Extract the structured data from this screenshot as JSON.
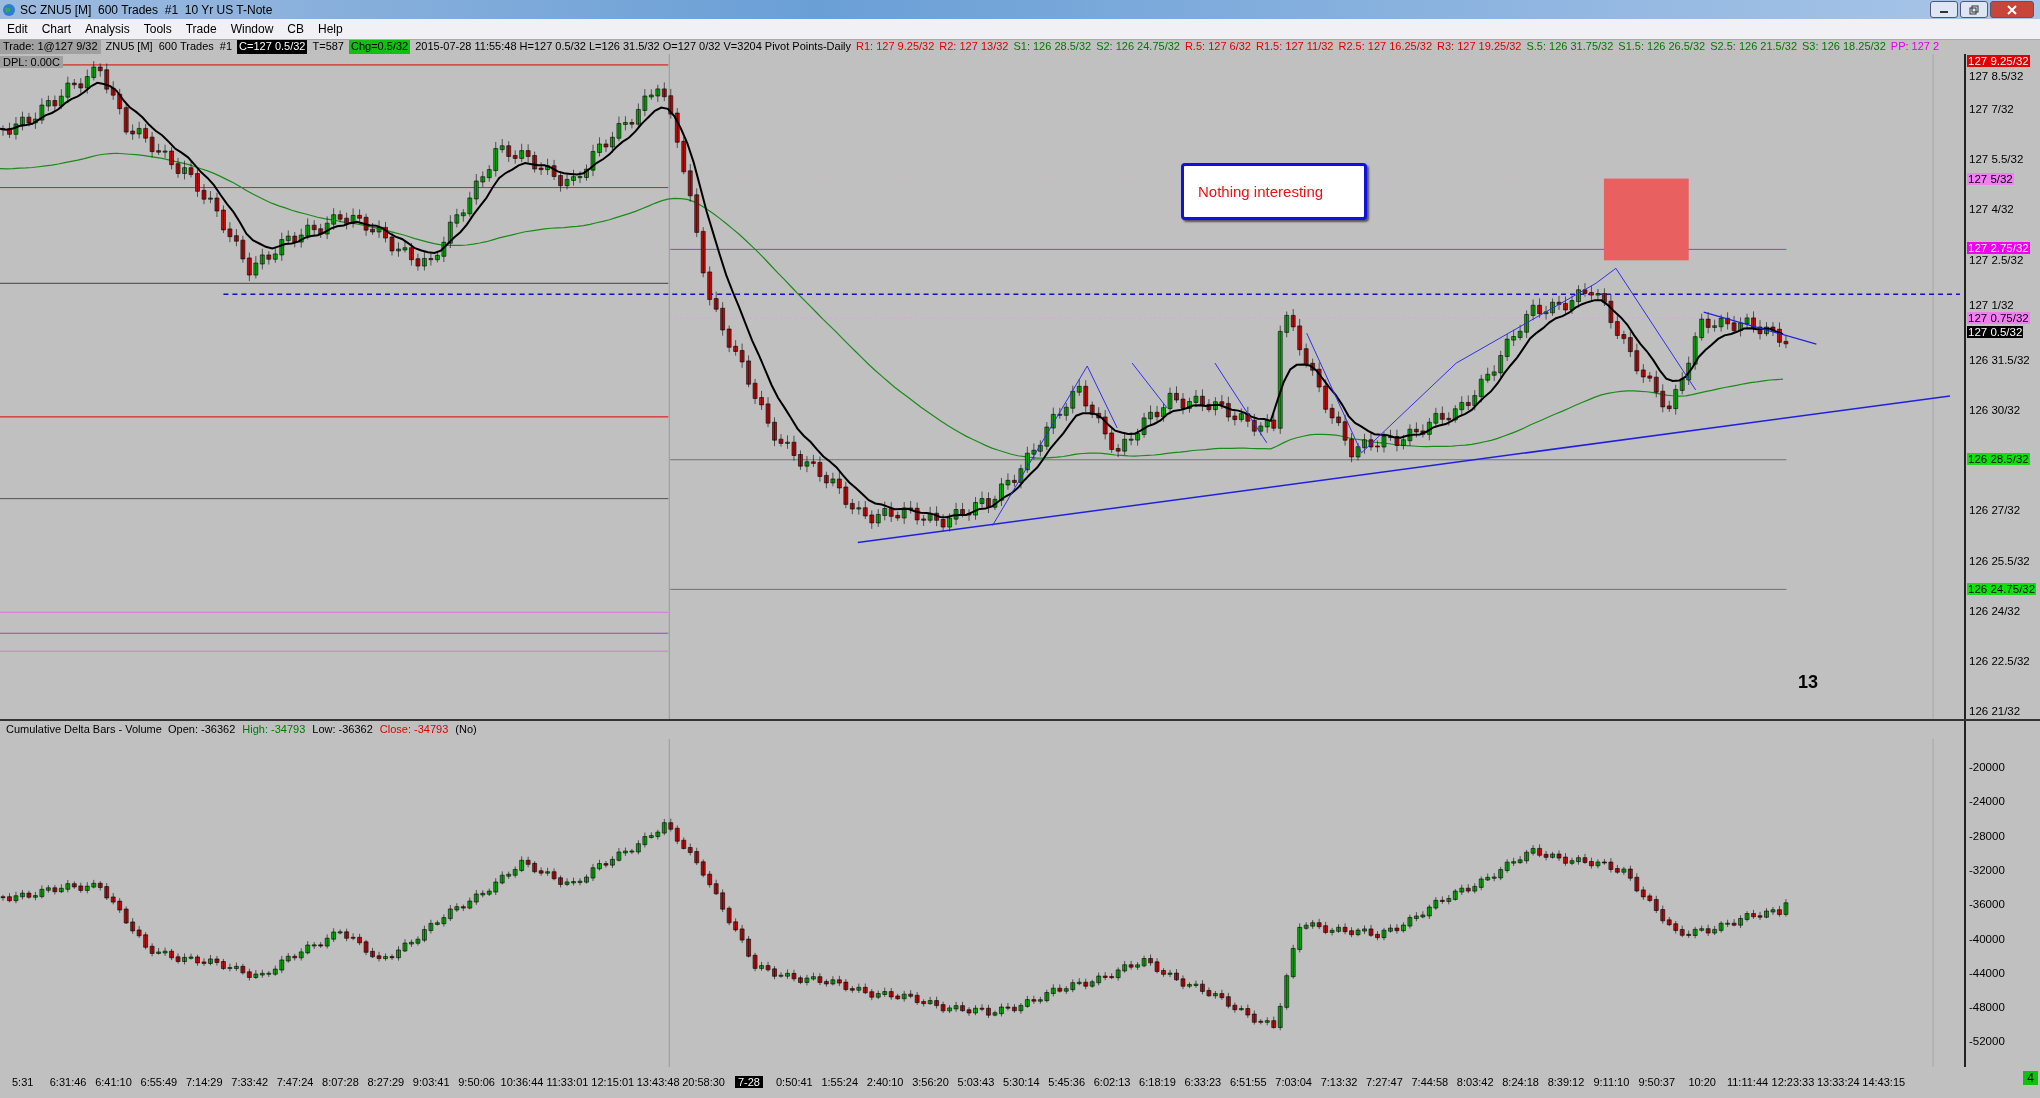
{
  "window": {
    "title": "SC ZNU5 [M]  600 Trades  #1  10 Yr US T-Note"
  },
  "menu": [
    "Edit",
    "Chart",
    "Analysis",
    "Tools",
    "Trade",
    "Window",
    "CB",
    "Help"
  ],
  "info_bar": [
    {
      "text": "Trade: 1@127 9/32",
      "kind": "label"
    },
    {
      "text": "ZNU5 [M]  600 Trades  #1",
      "kind": "plain"
    },
    {
      "text": "C=127 0.5/32",
      "kind": "dark"
    },
    {
      "text": "T=587",
      "kind": "plain"
    },
    {
      "text": "Chg=0.5/32",
      "kind": "up"
    },
    {
      "text": "2015-07-28 11:55:48 H=127 0.5/32 L=126 31.5/32 O=127 0/32 V=3204 Pivot Points-Daily",
      "kind": "plain"
    },
    {
      "text": "R1: 127 9.25/32",
      "kind": "resistance"
    },
    {
      "text": "R2: 127 13/32",
      "kind": "resistance"
    },
    {
      "text": "S1: 126 28.5/32",
      "kind": "support"
    },
    {
      "text": "S2: 126 24.75/32",
      "kind": "support"
    },
    {
      "text": "R.5: 127 6/32",
      "kind": "resistance"
    },
    {
      "text": "R1.5: 127 11/32",
      "kind": "resistance"
    },
    {
      "text": "R2.5: 127 16.25/32",
      "kind": "resistance"
    },
    {
      "text": "R3: 127 19.25/32",
      "kind": "resistance"
    },
    {
      "text": "S.5: 126 31.75/32",
      "kind": "support"
    },
    {
      "text": "S1.5: 126 26.5/32",
      "kind": "support"
    },
    {
      "text": "S2.5: 126 21.5/32",
      "kind": "support"
    },
    {
      "text": "S3: 126 18.25/32",
      "kind": "support"
    },
    {
      "text": "PP: 127 2",
      "kind": "pivot"
    }
  ],
  "dpl_label": "DPL: 0.00C",
  "note": "Nothing interesting",
  "bar_count": "13",
  "price_axis": {
    "ticks": [
      "127 8.5/32",
      "127 7/32",
      "127 5.5/32",
      "127 4/32",
      "127 2.5/32",
      "127 1/32",
      "126 31.5/32",
      "126 30/32",
      "126 27/32",
      "126 25.5/32",
      "126 24/32",
      "126 22.5/32",
      "126 21/32"
    ],
    "markers": [
      {
        "text": "127 9.25/32",
        "kind": "resistance"
      },
      {
        "text": "127 5/32",
        "kind": "light-pivot"
      },
      {
        "text": "127 2.75/32",
        "kind": "pivot"
      },
      {
        "text": "127 0.75/32",
        "kind": "light-pivot"
      },
      {
        "text": "127 0.5/32",
        "kind": "last"
      },
      {
        "text": "126 28.5/32",
        "kind": "support"
      },
      {
        "text": "126 24.75/32",
        "kind": "support"
      }
    ]
  },
  "delta_pane": {
    "header": [
      {
        "text": "Cumulative Delta Bars - Volume  Open: -36362",
        "kind": "plain"
      },
      {
        "text": "High: -34793",
        "kind": "high"
      },
      {
        "text": "Low: -36362",
        "kind": "plain"
      },
      {
        "text": "Close: -34793",
        "kind": "close"
      },
      {
        "text": "(No)",
        "kind": "plain"
      }
    ],
    "ticks": [
      "-20000",
      "-24000",
      "-28000",
      "-32000",
      "-36000",
      "-40000",
      "-44000",
      "-48000",
      "-52000"
    ]
  },
  "time_axis": [
    {
      "text": "5:31",
      "selected": false
    },
    {
      "text": "6:31:46",
      "selected": false
    },
    {
      "text": "6:41:10",
      "selected": false
    },
    {
      "text": "6:55:49",
      "selected": false
    },
    {
      "text": "7:14:29",
      "selected": false
    },
    {
      "text": "7:33:42",
      "selected": false
    },
    {
      "text": "7:47:24",
      "selected": false
    },
    {
      "text": "8:07:28",
      "selected": false
    },
    {
      "text": "8:27:29",
      "selected": false
    },
    {
      "text": "9:03:41",
      "selected": false
    },
    {
      "text": "9:50:06",
      "selected": false
    },
    {
      "text": "10:36:44",
      "selected": false
    },
    {
      "text": "11:33:01",
      "selected": false
    },
    {
      "text": "12:15:01",
      "selected": false
    },
    {
      "text": "13:43:48",
      "selected": false
    },
    {
      "text": "20:58:30",
      "selected": false
    },
    {
      "text": "7-28",
      "selected": true
    },
    {
      "text": "0:50:41",
      "selected": false
    },
    {
      "text": "1:55:24",
      "selected": false
    },
    {
      "text": "2:40:10",
      "selected": false
    },
    {
      "text": "3:56:20",
      "selected": false
    },
    {
      "text": "5:03:43",
      "selected": false
    },
    {
      "text": "5:30:14",
      "selected": false
    },
    {
      "text": "5:45:36",
      "selected": false
    },
    {
      "text": "6:02:13",
      "selected": false
    },
    {
      "text": "6:18:19",
      "selected": false
    },
    {
      "text": "6:33:23",
      "selected": false
    },
    {
      "text": "6:51:55",
      "selected": false
    },
    {
      "text": "7:03:04",
      "selected": false
    },
    {
      "text": "7:13:32",
      "selected": false
    },
    {
      "text": "7:27:47",
      "selected": false
    },
    {
      "text": "7:44:58",
      "selected": false
    },
    {
      "text": "8:03:42",
      "selected": false
    },
    {
      "text": "8:24:18",
      "selected": false
    },
    {
      "text": "8:39:12",
      "selected": false
    },
    {
      "text": "9:11:10",
      "selected": false
    },
    {
      "text": "9:50:37",
      "selected": false
    },
    {
      "text": "10:20",
      "selected": false
    },
    {
      "text": "11:11:44",
      "selected": false
    },
    {
      "text": "12:23:33",
      "selected": false
    },
    {
      "text": "13:33:24",
      "selected": false
    },
    {
      "text": "14:43:15",
      "selected": false
    }
  ],
  "corner_badge": "4"
}
